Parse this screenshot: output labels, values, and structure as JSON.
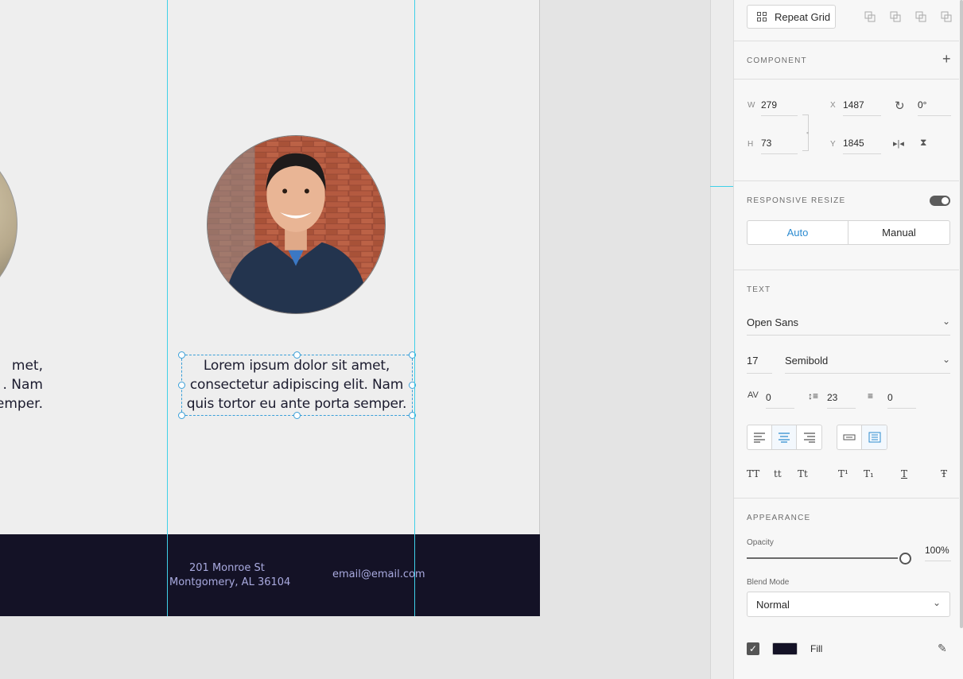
{
  "canvas": {
    "left_card_text": [
      "met,",
      ". Nam",
      "emper."
    ],
    "card_text": [
      "Lorem ipsum dolor sit amet,",
      "consectetur adipiscing elit. Nam",
      "quis tortor eu ante porta semper."
    ],
    "footer": {
      "address_line1": "201 Monroe St",
      "address_line2": "Montgomery, AL 36104",
      "email": "email@email.com"
    },
    "colors": {
      "footer_bg": "#141226",
      "guide": "#3fd0e8",
      "selection": "#3a9fd8"
    }
  },
  "panel": {
    "repeat_grid_label": "Repeat Grid",
    "component_title": "COMPONENT",
    "transform": {
      "w_label": "W",
      "w_value": "279",
      "h_label": "H",
      "h_value": "73",
      "x_label": "X",
      "x_value": "1487",
      "y_label": "Y",
      "y_value": "1845",
      "rotation_value": "0°"
    },
    "responsive": {
      "title": "RESPONSIVE RESIZE",
      "auto_label": "Auto",
      "manual_label": "Manual",
      "enabled": true
    },
    "text": {
      "title": "TEXT",
      "font_family": "Open Sans",
      "font_size": "17",
      "font_weight": "Semibold",
      "char_spacing": "0",
      "line_spacing": "23",
      "paragraph_spacing": "0",
      "case_buttons": [
        "TT",
        "tt",
        "Tt"
      ],
      "script_buttons": [
        "T¹",
        "T₁"
      ],
      "decoration_buttons": [
        "T",
        "Ŧ"
      ]
    },
    "appearance": {
      "title": "APPEARANCE",
      "opacity_label": "Opacity",
      "opacity_value": "100%",
      "blend_label": "Blend Mode",
      "blend_value": "Normal",
      "fill_label": "Fill",
      "fill_color": "#141226"
    }
  }
}
